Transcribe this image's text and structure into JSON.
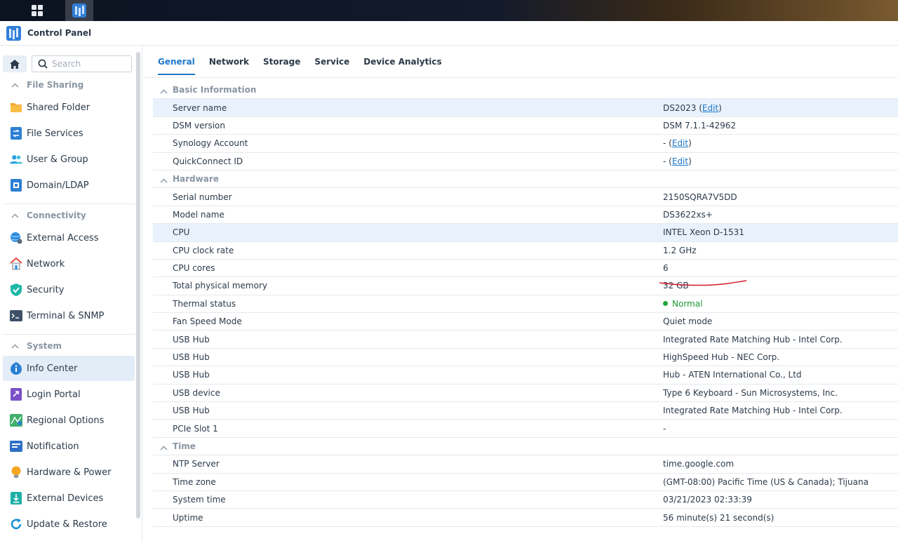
{
  "window": {
    "title": "Control Panel"
  },
  "sidebar": {
    "search_placeholder": "Search",
    "sections": [
      {
        "label": "File Sharing",
        "items": [
          {
            "label": "Shared Folder",
            "icon": "folder-icon"
          },
          {
            "label": "File Services",
            "icon": "file-services-icon"
          },
          {
            "label": "User & Group",
            "icon": "users-icon"
          },
          {
            "label": "Domain/LDAP",
            "icon": "domain-icon"
          }
        ]
      },
      {
        "label": "Connectivity",
        "items": [
          {
            "label": "External Access",
            "icon": "globe-icon"
          },
          {
            "label": "Network",
            "icon": "house-icon"
          },
          {
            "label": "Security",
            "icon": "shield-icon"
          },
          {
            "label": "Terminal & SNMP",
            "icon": "terminal-icon"
          }
        ]
      },
      {
        "label": "System",
        "items": [
          {
            "label": "Info Center",
            "icon": "info-icon",
            "active": true
          },
          {
            "label": "Login Portal",
            "icon": "portal-icon"
          },
          {
            "label": "Regional Options",
            "icon": "map-icon"
          },
          {
            "label": "Notification",
            "icon": "notification-icon"
          },
          {
            "label": "Hardware & Power",
            "icon": "bulb-icon"
          },
          {
            "label": "External Devices",
            "icon": "external-device-icon"
          },
          {
            "label": "Update & Restore",
            "icon": "refresh-icon"
          }
        ]
      }
    ]
  },
  "tabs": [
    {
      "label": "General",
      "active": true
    },
    {
      "label": "Network"
    },
    {
      "label": "Storage"
    },
    {
      "label": "Service"
    },
    {
      "label": "Device Analytics"
    }
  ],
  "info": {
    "groups": {
      "basic": "Basic Information",
      "hardware": "Hardware",
      "time": "Time"
    },
    "edit_label": "Edit",
    "basic": {
      "server_name": {
        "key": "Server name",
        "value": "DS2023"
      },
      "dsm_version": {
        "key": "DSM version",
        "value": "DSM 7.1.1-42962"
      },
      "synology_account": {
        "key": "Synology Account",
        "value": "-"
      },
      "quickconnect": {
        "key": "QuickConnect ID",
        "value": "-"
      }
    },
    "hardware": [
      {
        "key": "Serial number",
        "value": "2150SQRA7V5DD"
      },
      {
        "key": "Model name",
        "value": "DS3622xs+"
      },
      {
        "key": "CPU",
        "value": "INTEL Xeon D-1531"
      },
      {
        "key": "CPU clock rate",
        "value": "1.2 GHz"
      },
      {
        "key": "CPU cores",
        "value": "6"
      },
      {
        "key": "Total physical memory",
        "value": "32 GB"
      },
      {
        "key": "Thermal status",
        "value": "Normal"
      },
      {
        "key": "Fan Speed Mode",
        "value": "Quiet mode"
      },
      {
        "key": "USB Hub",
        "value": "Integrated Rate Matching Hub - Intel Corp."
      },
      {
        "key": "USB Hub",
        "value": "HighSpeed Hub - NEC Corp."
      },
      {
        "key": "USB Hub",
        "value": "Hub - ATEN International Co., Ltd"
      },
      {
        "key": "USB device",
        "value": "Type 6 Keyboard - Sun Microsystems, Inc."
      },
      {
        "key": "USB Hub",
        "value": "Integrated Rate Matching Hub - Intel Corp."
      },
      {
        "key": "PCIe Slot 1",
        "value": "-"
      }
    ],
    "time": [
      {
        "key": "NTP Server",
        "value": "time.google.com"
      },
      {
        "key": "Time zone",
        "value": "(GMT-08:00) Pacific Time (US & Canada); Tijuana"
      },
      {
        "key": "System time",
        "value": "03/21/2023 02:33:39"
      },
      {
        "key": "Uptime",
        "value": "56 minute(s) 21 second(s)"
      }
    ]
  },
  "colors": {
    "accent": "#1f78c8",
    "status_ok": "#22a83a",
    "highlight_row": "#e9f2fc",
    "annotation": "#d0182a"
  }
}
